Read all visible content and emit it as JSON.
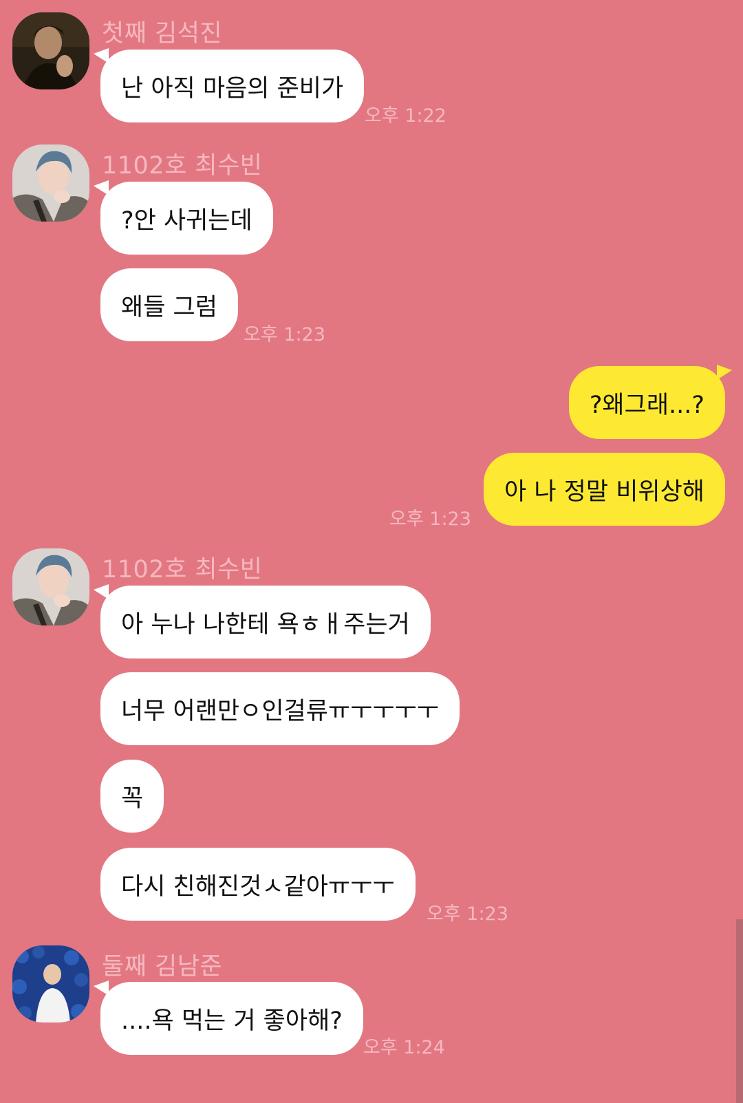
{
  "colors": {
    "background": "#e27782",
    "incoming_bubble": "#ffffff",
    "outgoing_bubble": "#fde932",
    "meta_text": "#f6b8c0"
  },
  "messages": [
    {
      "sender": "첫째 김석진",
      "avatar_icon": "profile-photo-icon",
      "bubbles": [
        "난 아직 마음의 준비가"
      ],
      "time": "오후 1:22"
    },
    {
      "sender": "1102호 최수빈",
      "avatar_icon": "profile-photo-icon",
      "bubbles": [
        "?안 사귀는데",
        "왜들 그럼"
      ],
      "time": "오후 1:23"
    },
    {
      "sender": "",
      "bubbles": [
        "?왜그래...?",
        "아 나 정말 비위상해"
      ],
      "time": "오후 1:23"
    },
    {
      "sender": "1102호 최수빈",
      "avatar_icon": "profile-photo-icon",
      "bubbles": [
        "아 누나 나한테 욕ㅎㅐ주는거",
        "너무 어랜만ㅇ인걸류ㅠㅜㅜㅜㅜ",
        "꼭",
        "다시 친해진것ㅅ같아ㅠㅜㅜ"
      ],
      "time": "오후 1:23"
    },
    {
      "sender": "둘째 김남준",
      "avatar_icon": "profile-photo-icon",
      "bubbles": [
        "....욕 먹는 거 좋아해?"
      ],
      "time": "오후 1:24"
    }
  ]
}
